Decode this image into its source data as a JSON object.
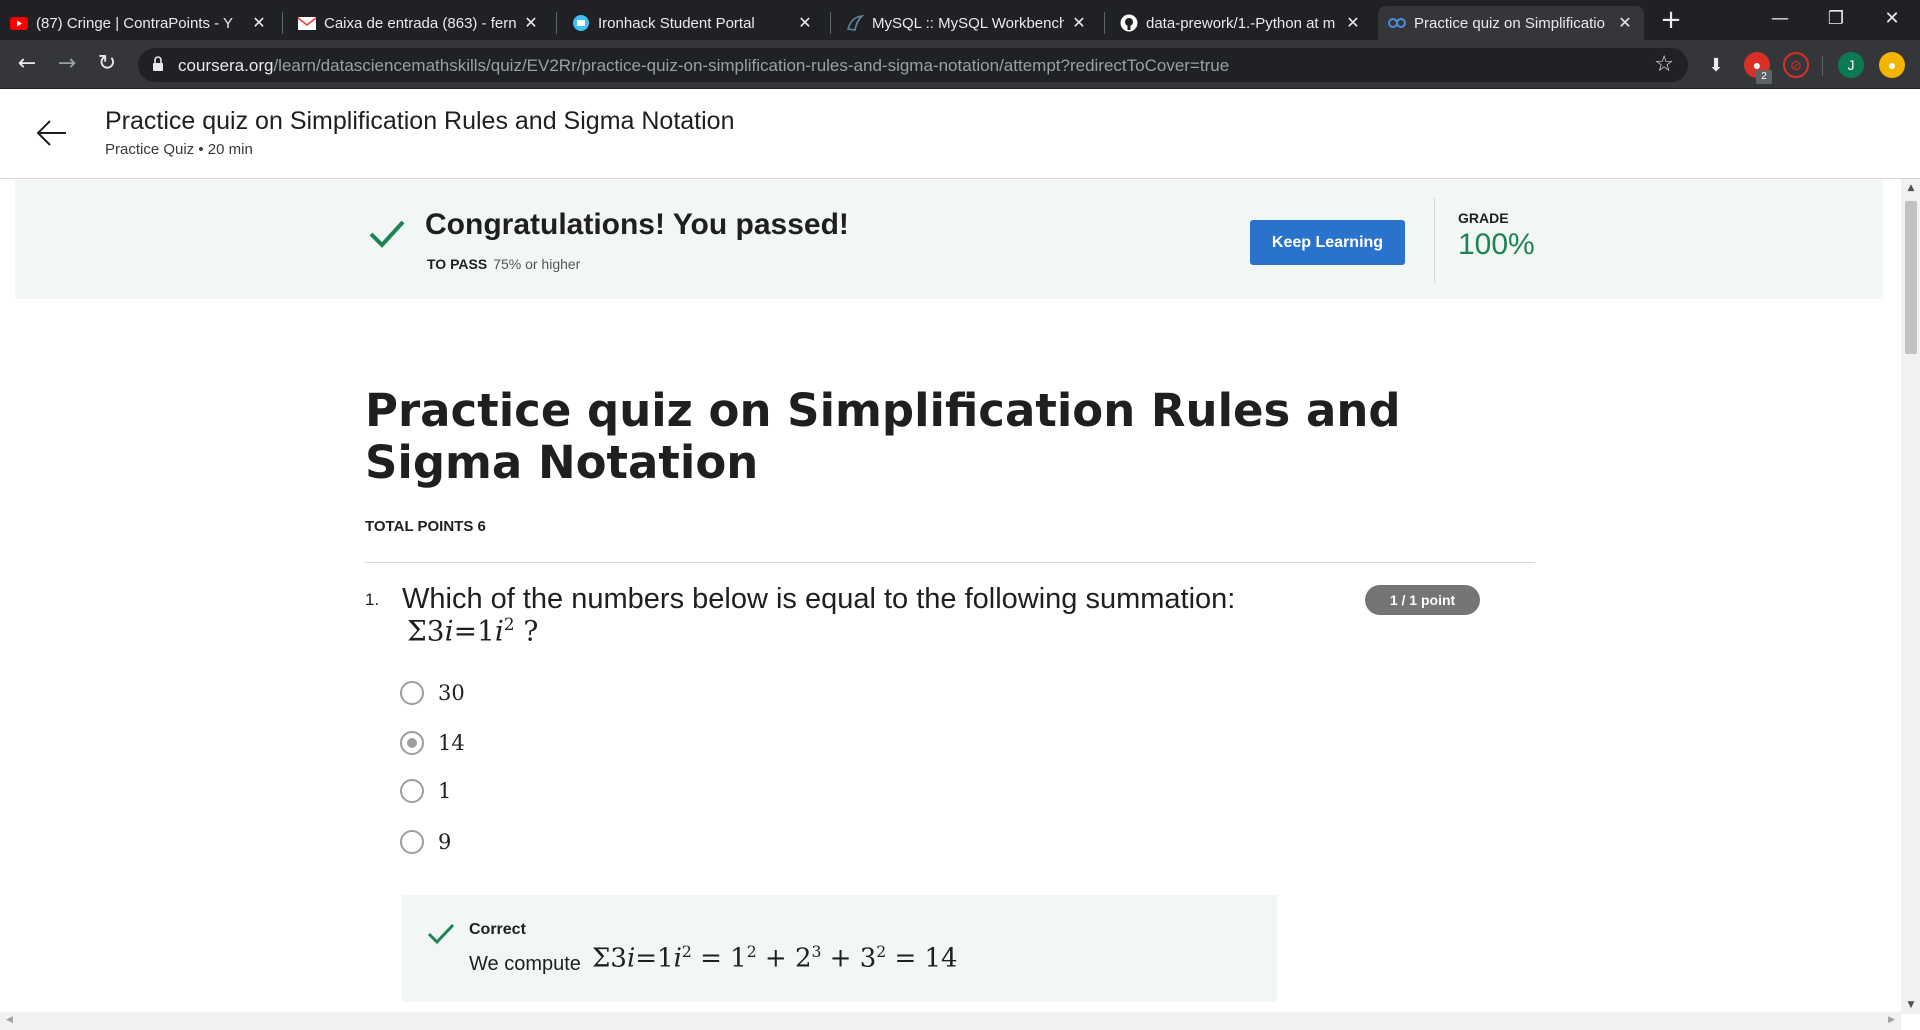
{
  "browser": {
    "tabs": [
      {
        "title": "(87) Cringe | ContraPoints - Y",
        "icon": "youtube-icon"
      },
      {
        "title": "Caixa de entrada (863) - ferna",
        "icon": "gmail-icon"
      },
      {
        "title": "Ironhack Student Portal",
        "icon": "ironhack-icon"
      },
      {
        "title": "MySQL :: MySQL Workbench",
        "icon": "mysql-icon"
      },
      {
        "title": "data-prework/1.-Python at m",
        "icon": "github-icon"
      },
      {
        "title": "Practice quiz on Simplificatio",
        "icon": "coursera-icon",
        "active": true
      }
    ],
    "url_host": "coursera.org",
    "url_path": "/learn/datasciencemathskills/quiz/EV2Rr/practice-quiz-on-simplification-rules-and-sigma-notation/attempt?redirectToCover=true",
    "extension_badge": "2",
    "profile_initial": "J"
  },
  "header": {
    "title": "Practice quiz on Simplification Rules and Sigma Notation",
    "subtitle": "Practice Quiz • 20 min"
  },
  "banner": {
    "message": "Congratulations! You passed!",
    "to_pass_label": "TO PASS",
    "to_pass_value": "75% or higher",
    "button_label": "Keep Learning",
    "grade_label": "GRADE",
    "grade_value": "100%"
  },
  "quiz": {
    "title": "Practice quiz on Simplification Rules and Sigma Notation",
    "total_points": "TOTAL POINTS 6",
    "questions": [
      {
        "number": "1.",
        "text": "Which of the numbers below is equal to the following summation:",
        "points_badge": "1 / 1 point",
        "options": [
          {
            "label": "30",
            "selected": false
          },
          {
            "label": "14",
            "selected": true
          },
          {
            "label": "1",
            "selected": false
          },
          {
            "label": "9",
            "selected": false
          }
        ],
        "feedback": {
          "label": "Correct",
          "text": "We compute"
        }
      }
    ]
  },
  "colors": {
    "primary_button": "#2a73cc",
    "success_green": "#1f8354",
    "banner_bg": "#f2f7f6"
  }
}
